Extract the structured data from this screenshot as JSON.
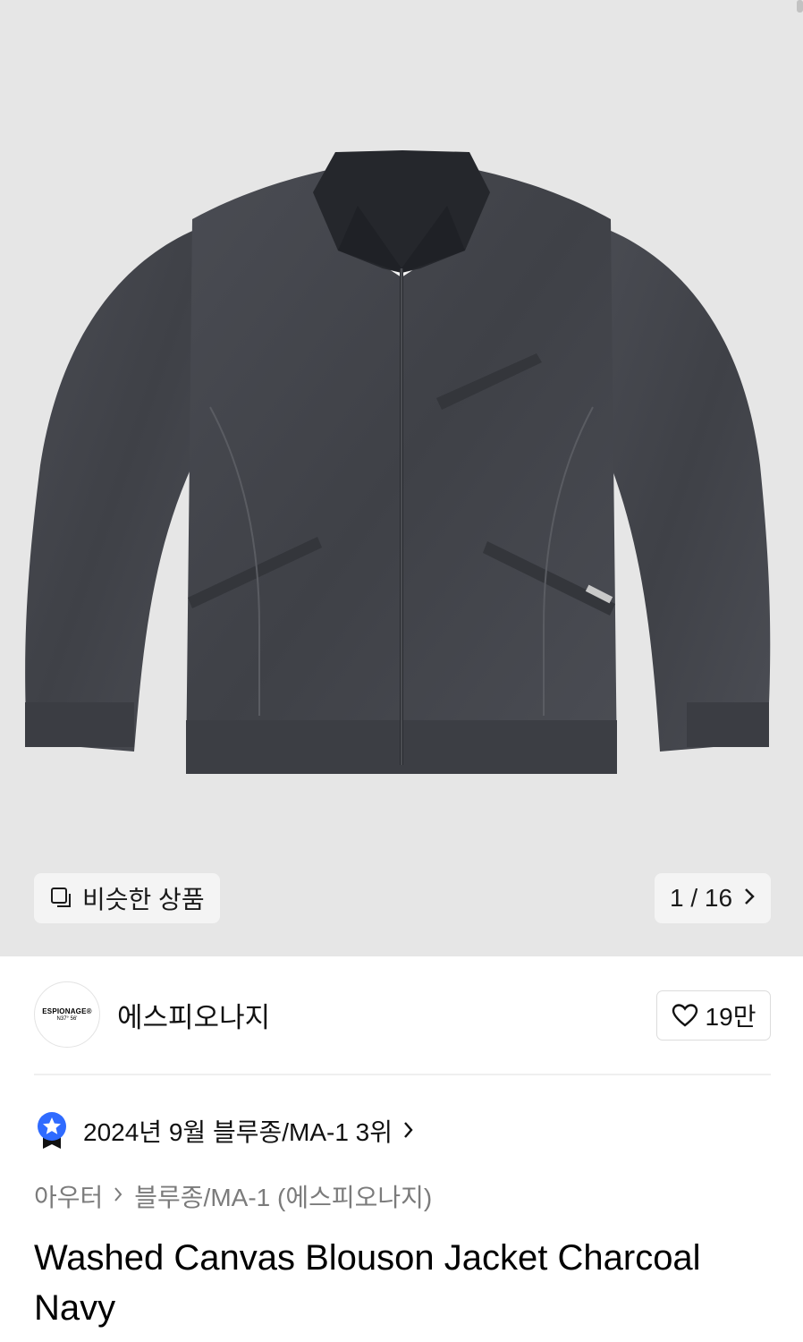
{
  "hero": {
    "similar_label": "비슷한 상품",
    "counter": "1 / 16",
    "icons": {
      "similar": "copy-icon",
      "next": "chevron-right-icon"
    }
  },
  "brand": {
    "logo_line1": "ESPIONAGE®",
    "logo_line2": "N37° 56'",
    "name": "에스피오나지",
    "like_count": "19만",
    "like_icon": "heart-icon"
  },
  "ranking": {
    "text": "2024년 9월 블루종/MA-1 3위",
    "icon": "badge-star-icon"
  },
  "breadcrumb": {
    "level1": "아우터",
    "level2": "블루종/MA-1 (에스피오나지)"
  },
  "product": {
    "title": "Washed Canvas Blouson Jacket Charcoal Navy"
  },
  "colors": {
    "hero_bg": "#e6e6e6",
    "badge_blue": "#2f6bff",
    "jacket": "#44464c"
  }
}
